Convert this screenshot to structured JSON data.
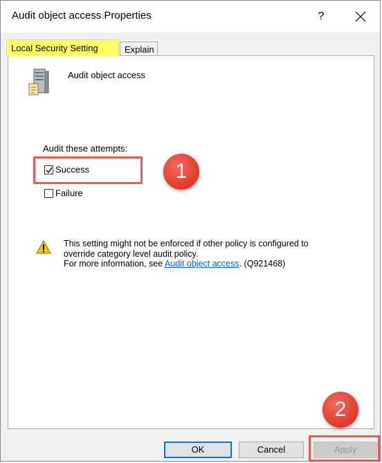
{
  "window": {
    "title": "Audit object access Properties",
    "help_label": "?",
    "close_icon": "close-icon"
  },
  "tabs": [
    {
      "label": "Local Security Setting",
      "active": true
    },
    {
      "label": "Explain",
      "active": false
    }
  ],
  "policy": {
    "name": "Audit object access",
    "icon": "server-policy-icon"
  },
  "audit": {
    "label": "Audit these attempts:",
    "options": [
      {
        "label": "Success",
        "checked": true
      },
      {
        "label": "Failure",
        "checked": false
      }
    ]
  },
  "warning": {
    "icon": "warning-icon",
    "line1": "This setting might not be enforced if other policy is configured to",
    "line2": "override category level audit policy.",
    "line3_prefix": "For more information, see ",
    "link": "Audit object access",
    "line3_suffix": ". (Q921468)"
  },
  "annotations": {
    "step1": "1",
    "step2": "2",
    "highlight_color": "#e85a5a"
  },
  "buttons": {
    "ok": "OK",
    "cancel": "Cancel",
    "apply": "Apply",
    "apply_enabled": false
  },
  "colors": {
    "tab_highlight": "#ffff66",
    "link": "#0066cc",
    "accent": "#0078d7"
  }
}
